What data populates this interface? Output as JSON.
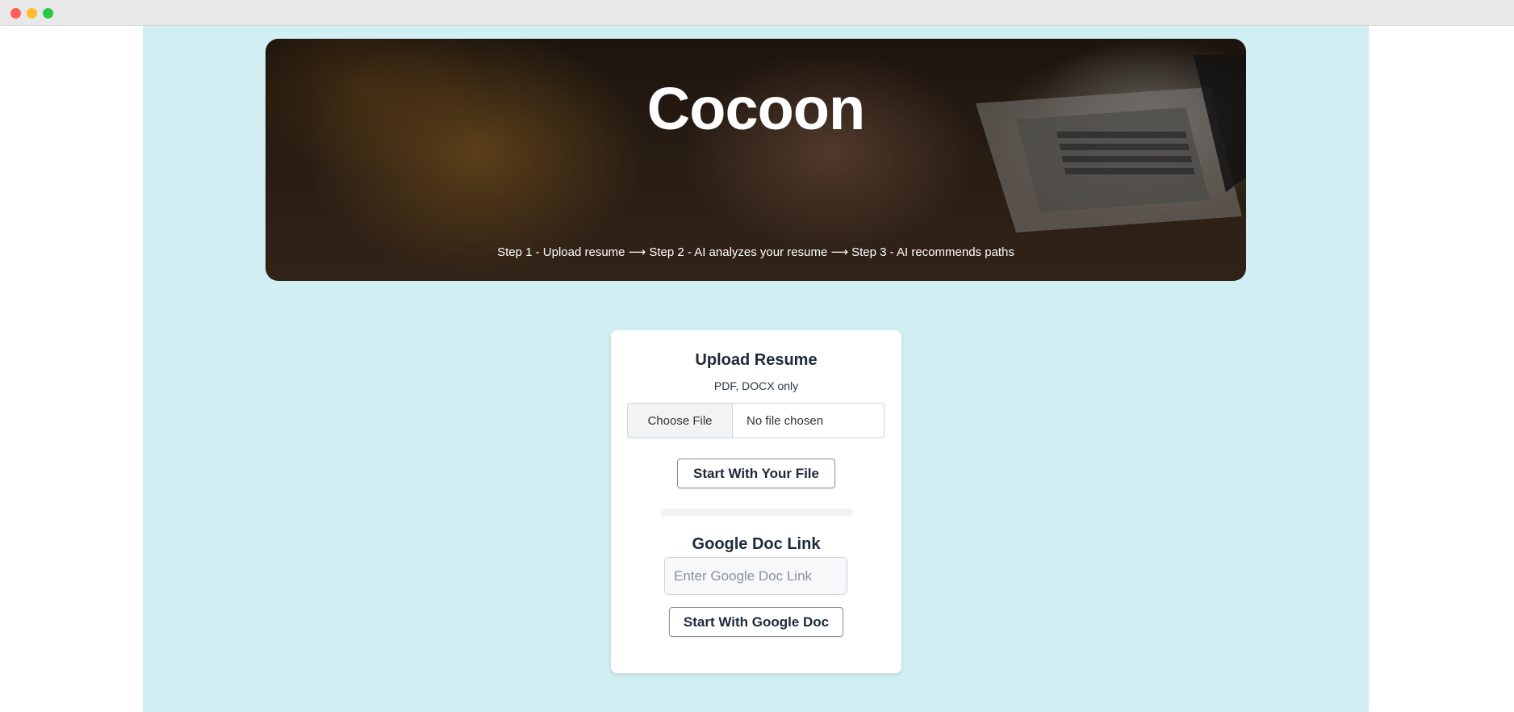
{
  "hero": {
    "title": "Cocoon",
    "steps": "Step 1 - Upload resume ⟶ Step 2 - AI analyzes your resume ⟶ Step 3 - AI recommends paths"
  },
  "upload": {
    "title": "Upload Resume",
    "subtitle": "PDF, DOCX only",
    "choose_file_label": "Choose File",
    "file_status": "No file chosen",
    "start_button": "Start With Your File"
  },
  "google": {
    "title": "Google Doc Link",
    "input_value": "",
    "input_placeholder": "Enter Google Doc Link",
    "start_button": "Start With Google Doc"
  },
  "colors": {
    "page_background": "#d2eff4",
    "card_background": "#ffffff",
    "heading_text": "#1e2a3a"
  }
}
